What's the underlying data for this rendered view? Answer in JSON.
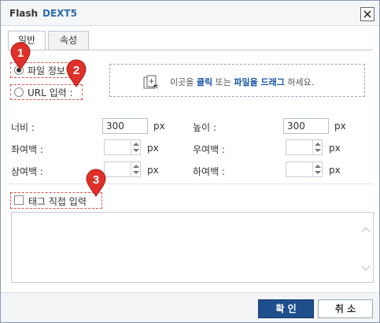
{
  "title": {
    "part1": "Flash",
    "part2": "DEXT5"
  },
  "tabs": [
    {
      "label": "일반",
      "active": true
    },
    {
      "label": "속성",
      "active": false
    }
  ],
  "source": {
    "file_option": {
      "label": "파일 정보",
      "checked": true
    },
    "url_option": {
      "label": "URL 입력 :",
      "checked": false
    },
    "upload": {
      "pre": "이곳을 ",
      "click": "클릭",
      "mid": " 또는 ",
      "drag": "파일을 드래그",
      "post": " 하세요."
    }
  },
  "size": {
    "width_label": "너비 :",
    "width_value": "300",
    "width_unit": "px",
    "height_label": "높이 :",
    "height_value": "300",
    "height_unit": "px"
  },
  "margins": {
    "left_label": "좌여백 :",
    "right_label": "우여백 :",
    "top_label": "상여백 :",
    "bottom_label": "하여백 :",
    "unit": "px"
  },
  "tag_input": {
    "label": "태그 직접 입력",
    "checked": false
  },
  "footer": {
    "ok_label": "확 인",
    "cancel_label": "취 소"
  },
  "markers": [
    "1",
    "2",
    "3"
  ],
  "colors": {
    "accent": "#1f4e8c",
    "marker": "#e0302a",
    "title_brand": "#2b6cb0"
  }
}
